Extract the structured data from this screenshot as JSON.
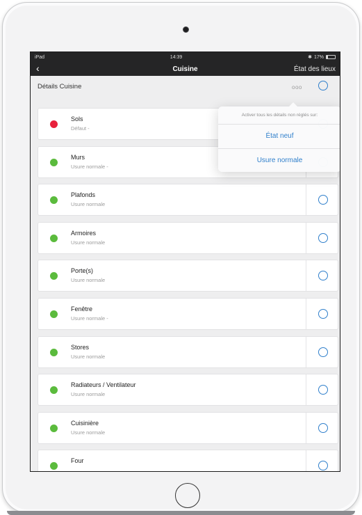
{
  "status": {
    "carrier": "iPad",
    "time": "14:39",
    "battery": "17%",
    "battery_level": 0.17
  },
  "nav": {
    "back_icon": "‹",
    "title": "Cuisine",
    "action": "État des lieux"
  },
  "section": {
    "title": "Détails Cuisine",
    "more_icon": "ooo"
  },
  "popover": {
    "hint": "Activer tous les détails non réglés sur:",
    "options": [
      "État neuf",
      "Usure normale"
    ]
  },
  "items": [
    {
      "name": "Sols",
      "status": "Défaut -",
      "color": "red"
    },
    {
      "name": "Murs",
      "status": "Usure normale -",
      "color": "green"
    },
    {
      "name": "Plafonds",
      "status": "Usure normale",
      "color": "green"
    },
    {
      "name": "Armoires",
      "status": "Usure normale",
      "color": "green"
    },
    {
      "name": "Porte(s)",
      "status": "Usure normale",
      "color": "green"
    },
    {
      "name": "Fenêtre",
      "status": "Usure normale -",
      "color": "green"
    },
    {
      "name": "Stores",
      "status": "Usure normale",
      "color": "green"
    },
    {
      "name": "Radiateurs / Ventilateur",
      "status": "Usure normale",
      "color": "green"
    },
    {
      "name": "Cuisinière",
      "status": "Usure normale",
      "color": "green"
    },
    {
      "name": "Four",
      "status": "",
      "color": "green"
    }
  ],
  "colors": {
    "accent": "#2f7fcb",
    "ok": "#5bbb3d",
    "defect": "#e8213c",
    "bar": "#252526"
  }
}
